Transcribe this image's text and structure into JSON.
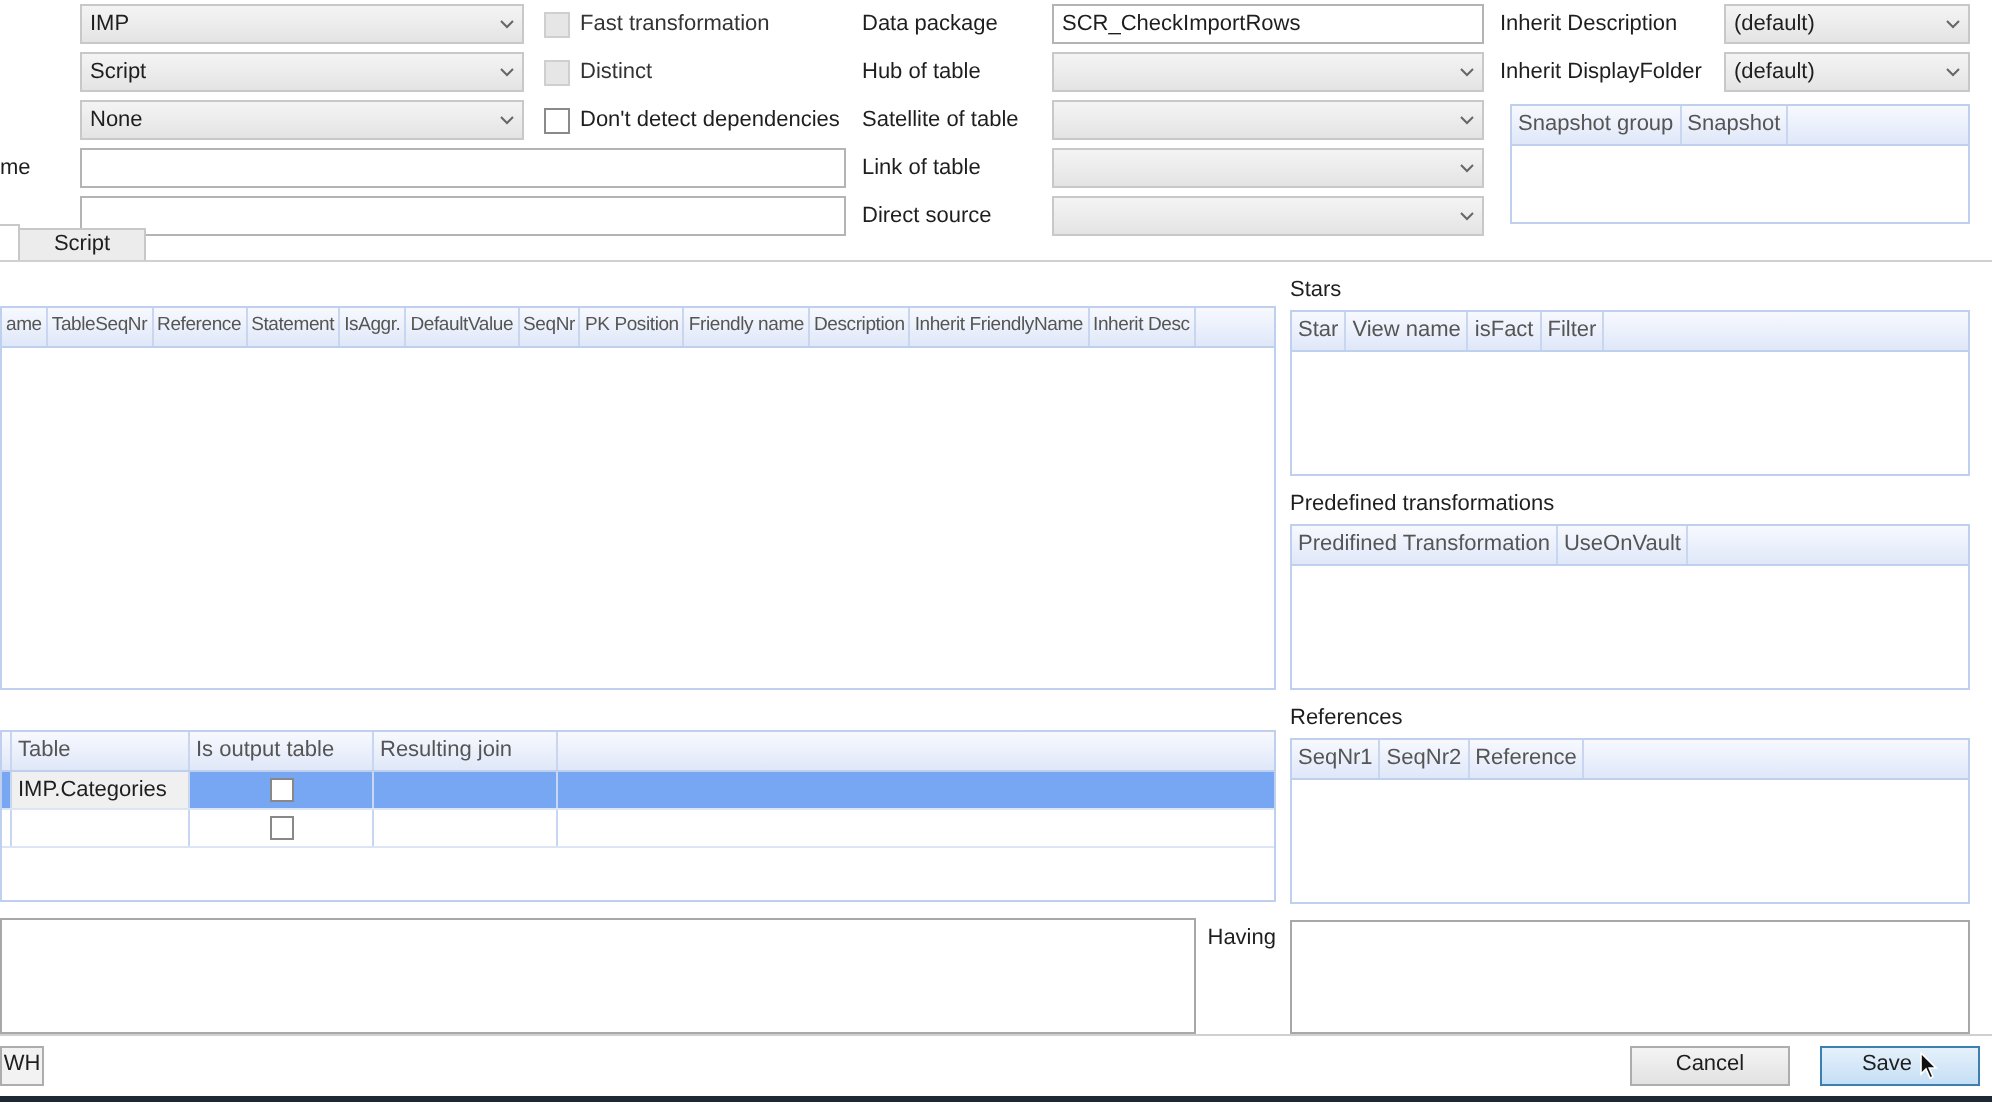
{
  "form": {
    "left": [
      {
        "value": "IMP",
        "kind": "combo"
      },
      {
        "value": "Script",
        "kind": "combo"
      },
      {
        "value": "None",
        "kind": "combo"
      },
      {
        "label": "me",
        "kind": "text"
      },
      {
        "kind": "text"
      }
    ],
    "checkboxes": [
      {
        "label": "Fast transformation",
        "checked": false,
        "disabled": true
      },
      {
        "label": "Distinct",
        "checked": false,
        "disabled": true
      },
      {
        "label": "Don't detect dependencies",
        "checked": false,
        "disabled": false
      }
    ],
    "middle": [
      {
        "label": "Data package",
        "value": "SCR_CheckImportRows",
        "kind": "text"
      },
      {
        "label": "Hub of table",
        "kind": "combo"
      },
      {
        "label": "Satellite of table",
        "kind": "combo"
      },
      {
        "label": "Link of table",
        "kind": "combo"
      },
      {
        "label": "Direct source",
        "kind": "combo"
      }
    ],
    "right": [
      {
        "label": "Inherit Description",
        "value": "(default)"
      },
      {
        "label": "Inherit DisplayFolder",
        "value": "(default)"
      }
    ],
    "snapshot_grid": {
      "columns": [
        "Snapshot group",
        "Snapshot"
      ]
    }
  },
  "tabs": [
    {
      "label": "Script",
      "selected": false
    }
  ],
  "columns_grid": {
    "columns": [
      "ame",
      "TableSeqNr",
      "Reference",
      "Statement",
      "IsAggr.",
      "DefaultValue",
      "SeqNr",
      "PK Position",
      "Friendly name",
      "Description",
      "Inherit FriendlyName",
      "Inherit Desc"
    ]
  },
  "tables_grid": {
    "columns": [
      "Table",
      "Is output table",
      "Resulting join"
    ],
    "rows": [
      {
        "table": "IMP.Categories",
        "is_output": false,
        "selected": true
      },
      {
        "table": "",
        "is_output": false,
        "selected": false
      }
    ]
  },
  "side": [
    {
      "title": "Stars",
      "columns": [
        "Star",
        "View name",
        "isFact",
        "Filter"
      ]
    },
    {
      "title": "Predefined transformations",
      "columns": [
        "Predifined Transformation",
        "UseOnVault"
      ]
    },
    {
      "title": "References",
      "columns": [
        "SeqNr1",
        "SeqNr2",
        "Reference"
      ]
    }
  ],
  "having": {
    "label": "Having"
  },
  "buttons": [
    {
      "label": "WH",
      "kind": "left"
    },
    {
      "label": "Cancel",
      "kind": "normal"
    },
    {
      "label": "Save",
      "kind": "default"
    }
  ]
}
